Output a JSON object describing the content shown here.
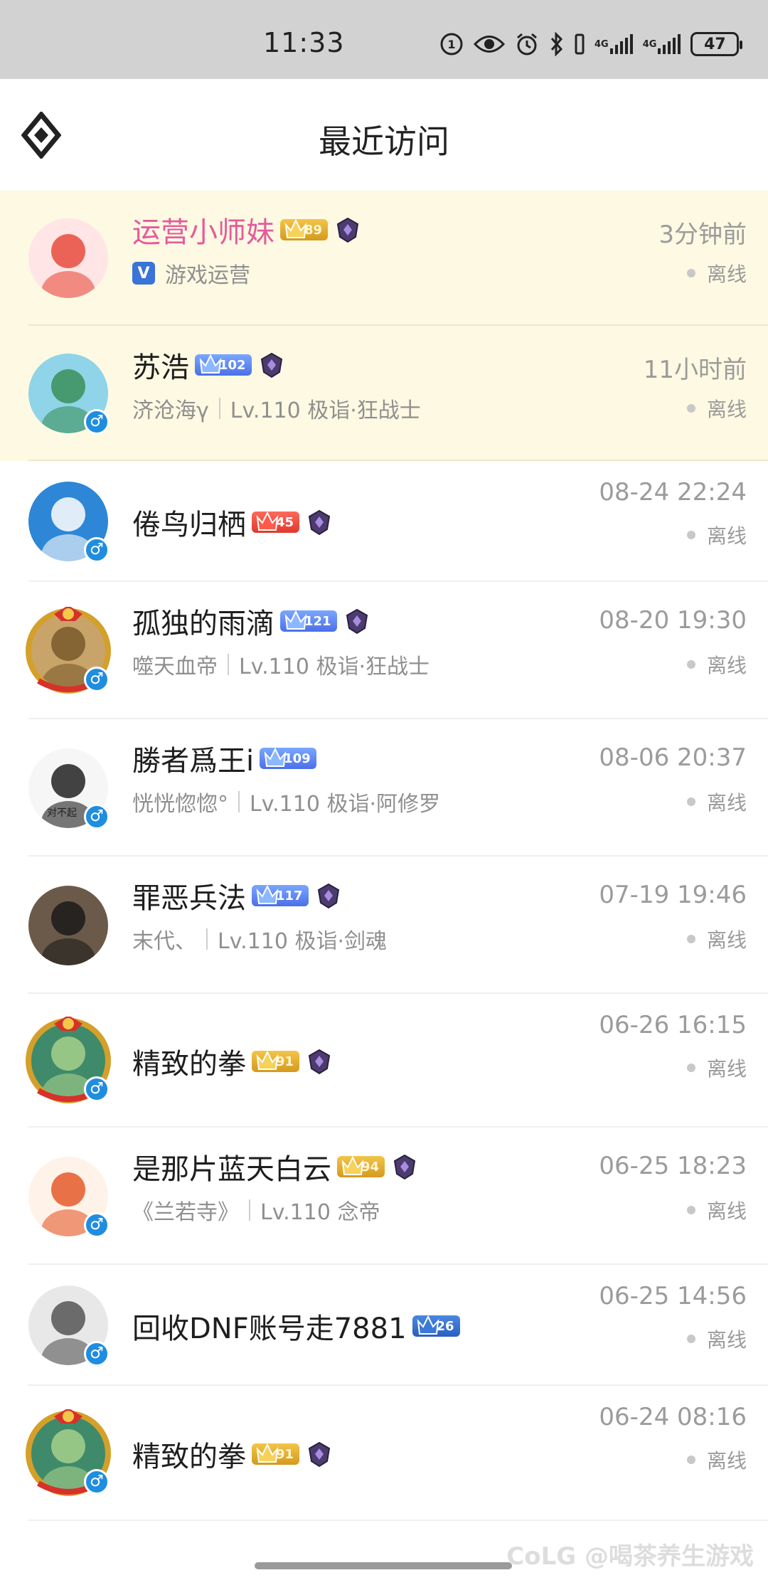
{
  "status_bar": {
    "time": "11:33",
    "battery": "47",
    "network_1": "4G",
    "network_2": "4G"
  },
  "header": {
    "title": "最近访问"
  },
  "visitors": [
    {
      "name": "运营小师妹",
      "level": "89",
      "badge_color": "gold",
      "sub_official": "V",
      "sub_left": "游戏运营",
      "sub_right": "",
      "time": "3分钟前",
      "status": "离线",
      "highlight": true,
      "gender": ""
    },
    {
      "name": "苏浩",
      "level": "102",
      "badge_color": "blue",
      "sub_left": "济沧海γ",
      "sub_right": "Lv.110 极诣·狂战士",
      "time": "11小时前",
      "status": "离线",
      "highlight": true,
      "gender": "♂"
    },
    {
      "name": "倦鸟归栖",
      "level": "45",
      "badge_color": "red",
      "sub_left": "",
      "sub_right": "",
      "time": "08-24 22:24",
      "status": "离线",
      "highlight": false,
      "gender": "♂"
    },
    {
      "name": "孤独的雨滴",
      "level": "121",
      "badge_color": "blue",
      "sub_left": "噬天血帝",
      "sub_right": "Lv.110 极诣·狂战士",
      "time": "08-20 19:30",
      "status": "离线",
      "highlight": false,
      "gender": "♂"
    },
    {
      "name": "勝者爲王i",
      "level": "109",
      "badge_color": "blue",
      "sub_left": "恍恍惚惚°",
      "sub_right": "Lv.110 极诣·阿修罗",
      "time": "08-06 20:37",
      "status": "离线",
      "highlight": false,
      "gender": "♂",
      "avatar_caption": "对不起"
    },
    {
      "name": "罪恶兵法",
      "level": "117",
      "badge_color": "blue",
      "sub_left": "末代、",
      "sub_right": "Lv.110 极诣·剑魂",
      "time": "07-19 19:46",
      "status": "离线",
      "highlight": false,
      "gender": ""
    },
    {
      "name": "精致的拳",
      "level": "91",
      "badge_color": "gold",
      "sub_left": "",
      "sub_right": "",
      "time": "06-26 16:15",
      "status": "离线",
      "highlight": false,
      "gender": "♂"
    },
    {
      "name": "是那片蓝天白云",
      "level": "94",
      "badge_color": "gold",
      "sub_left": "《兰若寺》",
      "sub_right": "Lv.110 念帝",
      "time": "06-25 18:23",
      "status": "离线",
      "highlight": false,
      "gender": "♂"
    },
    {
      "name": "回收DNF账号走7881",
      "level": "26",
      "badge_color": "navy",
      "sub_left": "",
      "sub_right": "",
      "time": "06-25 14:56",
      "status": "离线",
      "highlight": false,
      "gender": "♂"
    },
    {
      "name": "精致的拳",
      "level": "91",
      "badge_color": "gold",
      "sub_left": "",
      "sub_right": "",
      "time": "06-24 08:16",
      "status": "离线",
      "highlight": false,
      "gender": "♂"
    }
  ],
  "watermark": "CoLG @喝茶养生游戏"
}
